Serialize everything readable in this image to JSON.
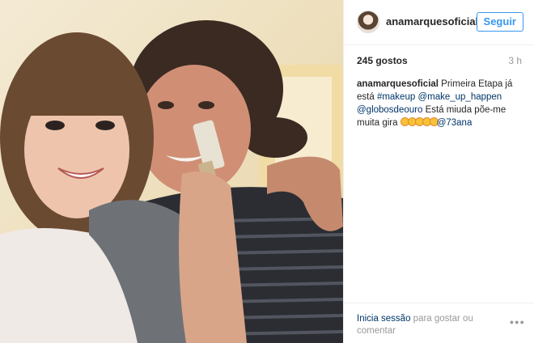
{
  "post": {
    "username": "anamarquesoficial",
    "follow_label": "Seguir",
    "likes": "245 gostos",
    "time_ago": "3 h",
    "caption": {
      "username": "anamarquesoficial",
      "text_1": " Primeira Etapa já está ",
      "hashtag": "#makeup",
      "mention_1": " @make_up_happen",
      "mention_2": "@globosdeouro",
      "text_2": " Está miuda põe-me muita gira ",
      "emoji_name": "heart-eyes-emoji",
      "emoji_count": 5,
      "mention_3": "@73ana"
    },
    "footer": {
      "login_link": "Inicia sessão",
      "login_rest": " para gostar ou comentar",
      "more_icon": "ellipsis-icon"
    }
  },
  "colors": {
    "accent": "#3897f0",
    "link": "#003569",
    "muted": "#999999"
  }
}
